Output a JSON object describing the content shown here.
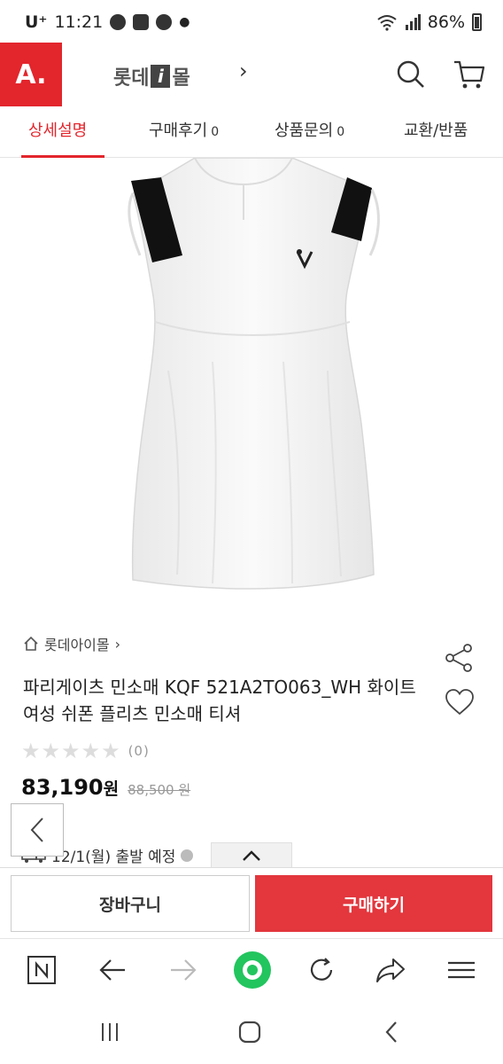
{
  "status_bar": {
    "carrier": "U⁺",
    "time": "11:21",
    "battery": "86%"
  },
  "header": {
    "logo": "A.",
    "mall_name_pre": "롯데",
    "mall_name_i": "i",
    "mall_name_post": "몰",
    "mall_arrow": "›"
  },
  "tabs": [
    {
      "label": "상세설명",
      "count": "",
      "active": true
    },
    {
      "label": "구매후기",
      "count": "0",
      "active": false
    },
    {
      "label": "상품문의",
      "count": "0",
      "active": false
    },
    {
      "label": "교환/반품",
      "count": "",
      "active": false
    }
  ],
  "product": {
    "breadcrumb": "롯데아이몰",
    "breadcrumb_arrow": "›",
    "title": "파리게이츠 민소매 KQF 521A2TO063_WH 화이트 여성 쉬폰 플리츠 민소매 티셔",
    "stars": "★★★★★",
    "rating": 0,
    "review_count": "(0)",
    "price": "83,190",
    "price_unit": "원",
    "original_price": "88,500 원",
    "shipping": "12/1(월) 출발 예정"
  },
  "actions": {
    "cart_label": "장바구니",
    "buy_label": "구매하기"
  },
  "colors": {
    "accent": "#e3252c",
    "buy_button": "#e3363d",
    "browser_home": "#22c55e"
  }
}
